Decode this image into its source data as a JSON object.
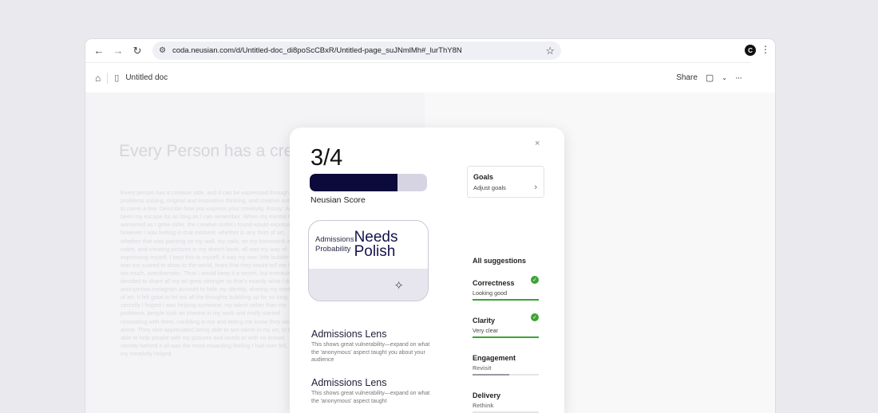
{
  "browser": {
    "url": "coda.neusian.com/d/Untitled-doc_di8poScCBxR/Untitled-page_suJNmlMh#_lurThY8N",
    "profile_initial": "C"
  },
  "docbar": {
    "doc_name": "Untitled doc",
    "share_label": "Share"
  },
  "document": {
    "title": "Every Person has a crea",
    "body": "Every person has a creative side, and it can be expressed through problems solving, original and innovative thinking, and creative outlets to name a few. Describe how you express your creativity. Essay: Art has been my escape for as long as I can remember. When my mental health worsened as I grew older, the creative outlet I found would express however I was feeling in that moment, whether in any form of art, whether that was painting on my wall, my nails, on my homework and notes, and creating pictures in my sketch book, all was my way of expressing myself. I kept this to myself, it was my own little bubble that I was too scared to show to the world, fears that they would tell me I'm too much, overdramatic. Thus I would keep it a secret, but eventually I decided to share all my art grew stronger so that's exactly what I did: an anonymous instagram account to hide my identity, sharing my mediums of art. It felt good to let out all the thoughts bubbling up for so long, but secretly I hoped I was helping someone. my talent rather than my problems, people took an interest in my work and really started resonating with them, confiding in me and letting me know they weren't alone. They also appreciated being able to see talent in my art, to be able to help people with my pictures and words or with no known identity behind it all was the most rewarding feeling I had ever felt, that my creativity helped"
  },
  "panel": {
    "close_glyph": "×",
    "score_text": "3/4",
    "score_fraction": 0.75,
    "score_label": "Neusian Score",
    "probability": {
      "label": "Admissions Probability",
      "value": "Needs Polish"
    },
    "lenses": [
      {
        "title": "Admissions Lens",
        "description": "This shows great vulnerability—expand on what the 'anonymous' aspect taught you about your audience"
      },
      {
        "title": "Admissions Lens",
        "description": "This shows great vulnerability—expand on what the 'anonymous' aspect taught"
      }
    ],
    "goals": {
      "title": "Goals",
      "subtitle": "Adjust goals"
    },
    "suggestions_heading": "All suggestions",
    "suggestions": [
      {
        "title": "Correctness",
        "subtitle": "Looking good",
        "progress": 1.0,
        "color": "#3ea336",
        "done": true
      },
      {
        "title": "Clarity",
        "subtitle": "Very clear",
        "progress": 1.0,
        "color": "#3ea336",
        "done": true
      },
      {
        "title": "Engagement",
        "subtitle": "Revisit",
        "progress": 0.55,
        "color": "#9a9aa2",
        "done": false
      },
      {
        "title": "Delivery",
        "subtitle": "Rethink",
        "progress": 0.0,
        "color": "#9a9aa2",
        "done": false
      }
    ]
  }
}
